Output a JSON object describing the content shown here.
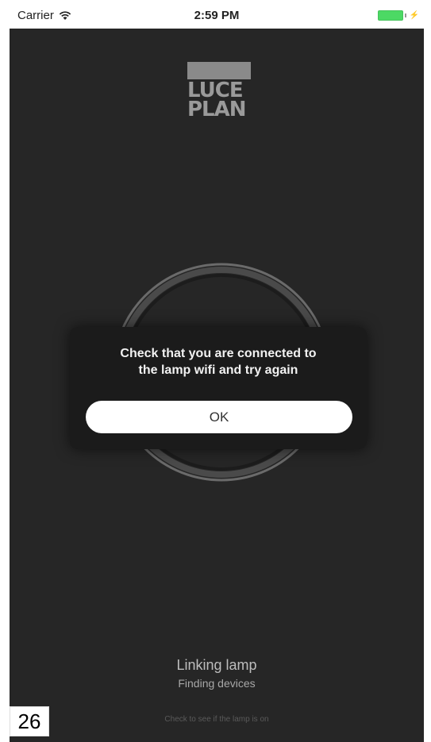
{
  "status_bar": {
    "carrier": "Carrier",
    "time": "2:59 PM",
    "wifi_icon": "wifi-icon",
    "battery_color": "#4cd964"
  },
  "logo": {
    "line1": "LUCE",
    "line2": "PLAN"
  },
  "dialog": {
    "message": "Check that you are connected to\nthe lamp wifi and try again",
    "ok_label": "OK"
  },
  "linking": {
    "title": "Linking lamp",
    "subtitle": "Finding devices",
    "hint": "Check to see if the lamp is on"
  },
  "page_number": "26",
  "colors": {
    "background": "#262626",
    "dialog": "#1b1b1b",
    "button": "#ffffff"
  }
}
